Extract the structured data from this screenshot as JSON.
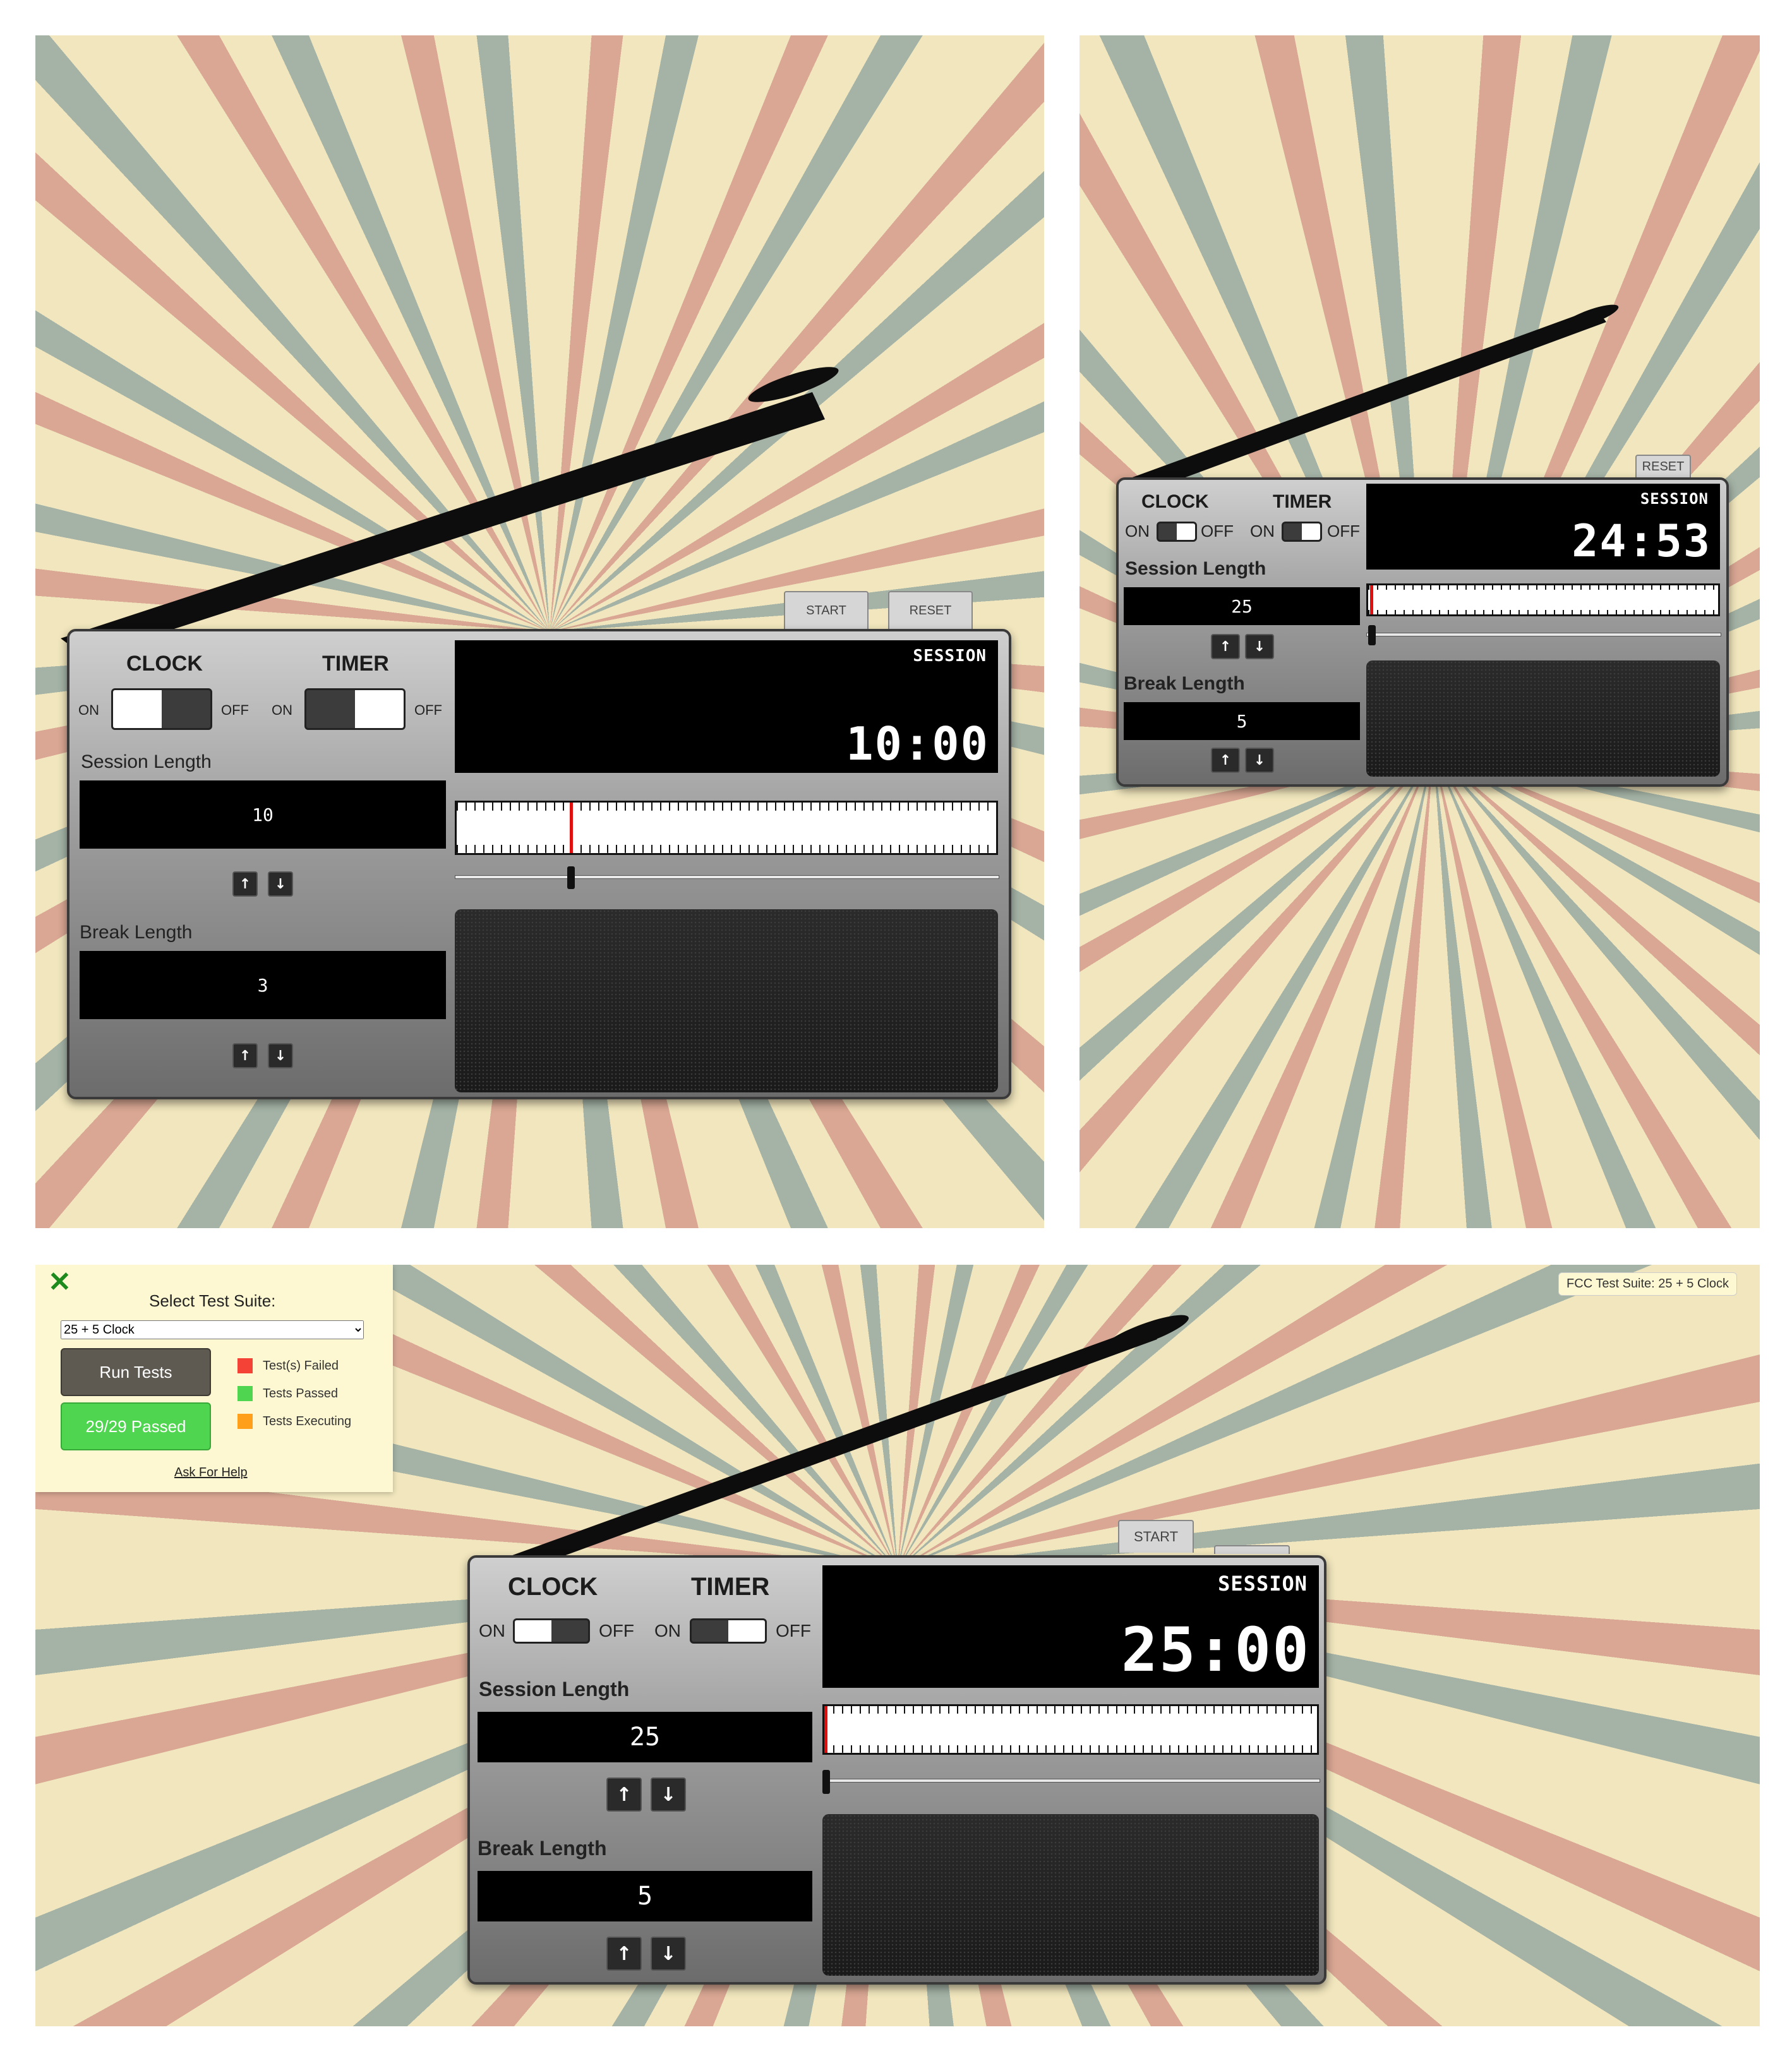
{
  "panel_a": {
    "clock_label": "CLOCK",
    "timer_label": "TIMER",
    "on": "ON",
    "off": "OFF",
    "session_label": "Session Length",
    "session_value": "10",
    "break_label": "Break Length",
    "break_value": "3",
    "mode": "SESSION",
    "time": "10:00",
    "start": "START",
    "reset": "RESET",
    "up_icon": "↑",
    "down_icon": "↓",
    "clock_switch": "on",
    "timer_switch": "off"
  },
  "panel_b": {
    "clock_label": "CLOCK",
    "timer_label": "TIMER",
    "on": "ON",
    "off": "OFF",
    "session_label": "Session Length",
    "session_value": "25",
    "break_label": "Break Length",
    "break_value": "5",
    "mode": "SESSION",
    "time": "24:53",
    "reset": "RESET",
    "up_icon": "↑",
    "down_icon": "↓",
    "clock_switch": "off",
    "timer_switch": "off"
  },
  "panel_c": {
    "clock_label": "CLOCK",
    "timer_label": "TIMER",
    "on": "ON",
    "off": "OFF",
    "session_label": "Session Length",
    "session_value": "25",
    "break_label": "Break Length",
    "break_value": "5",
    "mode": "SESSION",
    "time": "25:00",
    "start": "START",
    "up_icon": "↑",
    "down_icon": "↓",
    "clock_switch": "on",
    "timer_switch": "off"
  },
  "fcc": {
    "close_icon": "✕",
    "title": "Select Test Suite:",
    "suite_selected": "25 + 5 Clock",
    "run_label": "Run Tests",
    "result_label": "29/29 Passed",
    "legend": [
      {
        "label": "Test(s) Failed",
        "color": "#f44336"
      },
      {
        "label": "Tests Passed",
        "color": "#4fd54f"
      },
      {
        "label": "Tests Executing",
        "color": "#ff9f1a"
      }
    ],
    "help": "Ask For Help",
    "tag": "FCC Test Suite: 25 + 5 Clock"
  }
}
